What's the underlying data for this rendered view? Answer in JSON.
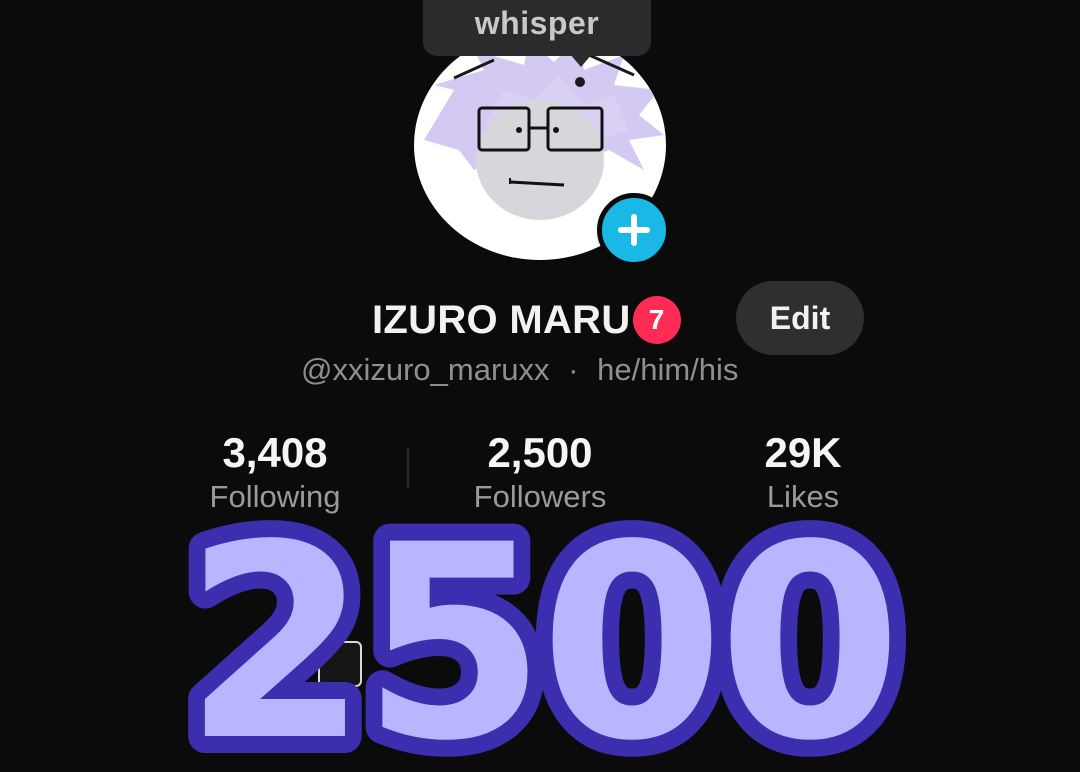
{
  "tooltip": {
    "label": "whisper"
  },
  "profile": {
    "display_name": "IZURO MARU",
    "notification_count": "7",
    "edit_label": "Edit",
    "handle": "@xxizuro_maruxx",
    "separator": "·",
    "pronouns": "he/him/his"
  },
  "stats": [
    {
      "value": "3,408",
      "label": "Following"
    },
    {
      "value": "2,500",
      "label": "Followers"
    },
    {
      "value": "29K",
      "label": "Likes"
    }
  ],
  "overlay": {
    "text": "2500",
    "fill_color": "#b9b6ff",
    "stroke_color": "#3b2fb0"
  },
  "colors": {
    "background": "#0b0b0c",
    "accent_blue": "#1ab8e4",
    "badge_red": "#fe2c55",
    "button_gray": "#2f2f32"
  },
  "icons": {
    "avatar": "cartoon-avatar-with-glasses",
    "add": "plus-icon"
  }
}
